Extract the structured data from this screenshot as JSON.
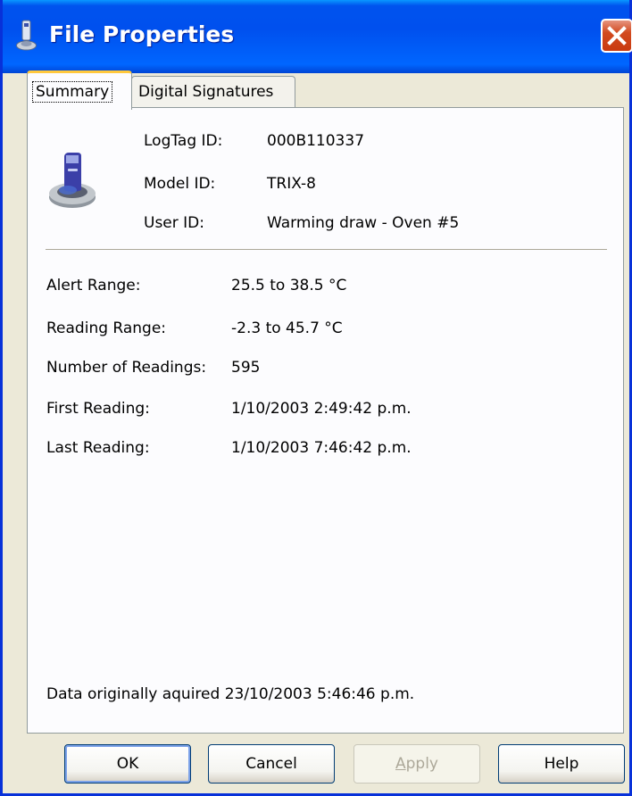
{
  "window": {
    "title": "File Properties",
    "icon": "logtag-app-icon",
    "accent": "#0053ee"
  },
  "tabs": [
    {
      "label": "Summary",
      "selected": true
    },
    {
      "label": "Digital Signatures",
      "selected": false
    }
  ],
  "device": {
    "icon": "logtag-device-icon",
    "rows": [
      {
        "label": "LogTag ID:",
        "value": "000B110337"
      },
      {
        "label": "Model ID:",
        "value": "TRIX-8"
      },
      {
        "label": "User ID:",
        "value": "Warming draw - Oven #5"
      }
    ]
  },
  "readings": [
    {
      "label": "Alert Range:",
      "value": "25.5 to 38.5 °C"
    },
    {
      "label": "Reading Range:",
      "value": "-2.3 to 45.7 °C"
    },
    {
      "label": "Number of Readings:",
      "value": "595"
    },
    {
      "label": "First Reading:",
      "value": "1/10/2003 2:49:42 p.m."
    },
    {
      "label": "Last Reading:",
      "value": "1/10/2003 7:46:42 p.m."
    }
  ],
  "footer": "Data originally aquired 23/10/2003 5:46:46 p.m.",
  "buttons": {
    "ok": "OK",
    "cancel": "Cancel",
    "apply_prefix": "",
    "apply_mnemonic": "A",
    "apply_rest": "pply",
    "apply_enabled": false,
    "help": "Help"
  }
}
